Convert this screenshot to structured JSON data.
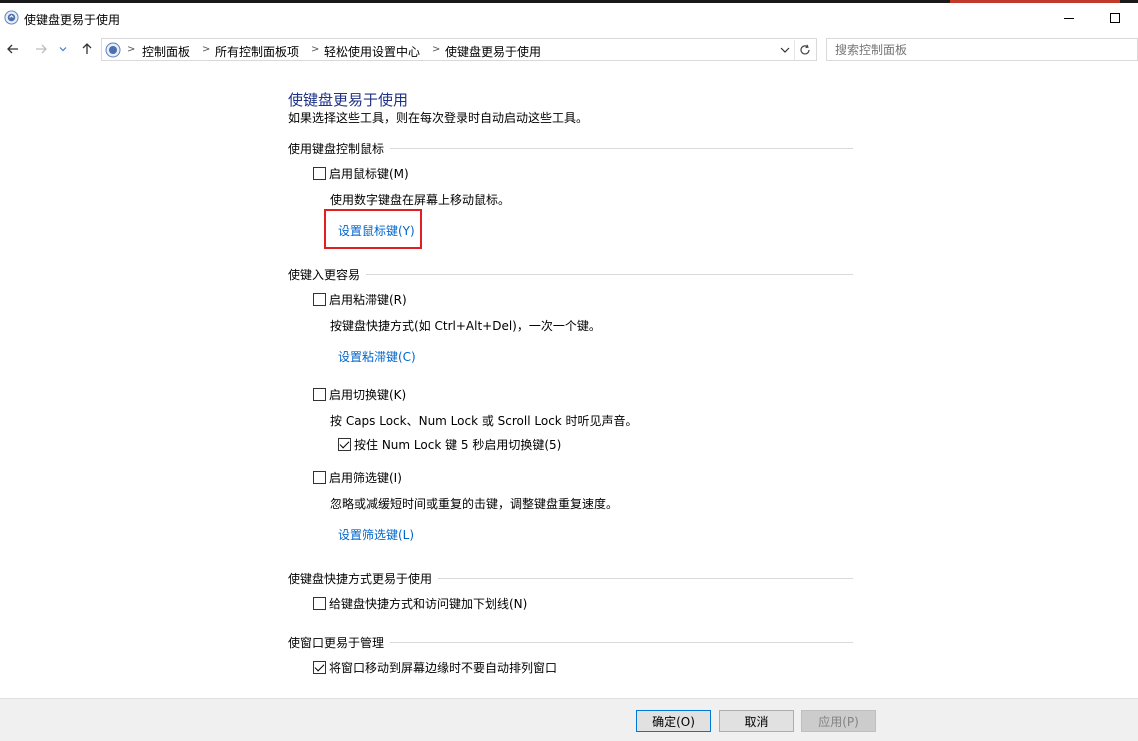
{
  "window": {
    "title": "使键盘更易于使用"
  },
  "nav": {
    "breadcrumbs": [
      "控制面板",
      "所有控制面板项",
      "轻松使用设置中心",
      "使键盘更易于使用"
    ],
    "search_placeholder": "搜索控制面板"
  },
  "page": {
    "title": "使键盘更易于使用",
    "description": "如果选择这些工具，则在每次登录时自动启动这些工具。"
  },
  "sections": {
    "mouse": {
      "header": "使用键盘控制鼠标",
      "mouse_keys": {
        "label": "启用鼠标键(M)",
        "checked": false
      },
      "mouse_keys_desc": "使用数字键盘在屏幕上移动鼠标。",
      "mouse_keys_link": "设置鼠标键(Y)"
    },
    "typing": {
      "header": "使键入更容易",
      "sticky": {
        "label": "启用粘滞键(R)",
        "checked": false
      },
      "sticky_desc": "按键盘快捷方式(如 Ctrl+Alt+Del)，一次一个键。",
      "sticky_link": "设置粘滞键(C)",
      "toggle": {
        "label": "启用切换键(K)",
        "checked": false
      },
      "toggle_desc": "按 Caps Lock、Num Lock 或 Scroll Lock 时听见声音。",
      "toggle_hold": {
        "label": "按住 Num Lock 键 5 秒启用切换键(5)",
        "checked": true
      },
      "filter": {
        "label": "启用筛选键(I)",
        "checked": false
      },
      "filter_desc": "忽略或减缓短时间或重复的击键，调整键盘重复速度。",
      "filter_link": "设置筛选键(L)"
    },
    "shortcuts": {
      "header": "使键盘快捷方式更易于使用",
      "underline": {
        "label": "给键盘快捷方式和访问键加下划线(N)",
        "checked": false
      }
    },
    "windows": {
      "header": "使窗口更易于管理",
      "no_arrange": {
        "label": "将窗口移动到屏幕边缘时不要自动排列窗口",
        "checked": true
      }
    }
  },
  "footer": {
    "ok": "确定(O)",
    "cancel": "取消",
    "apply": "应用(P)"
  },
  "colors": {
    "link": "#0066cc",
    "title": "#1e3287",
    "highlight": "#e02020"
  }
}
